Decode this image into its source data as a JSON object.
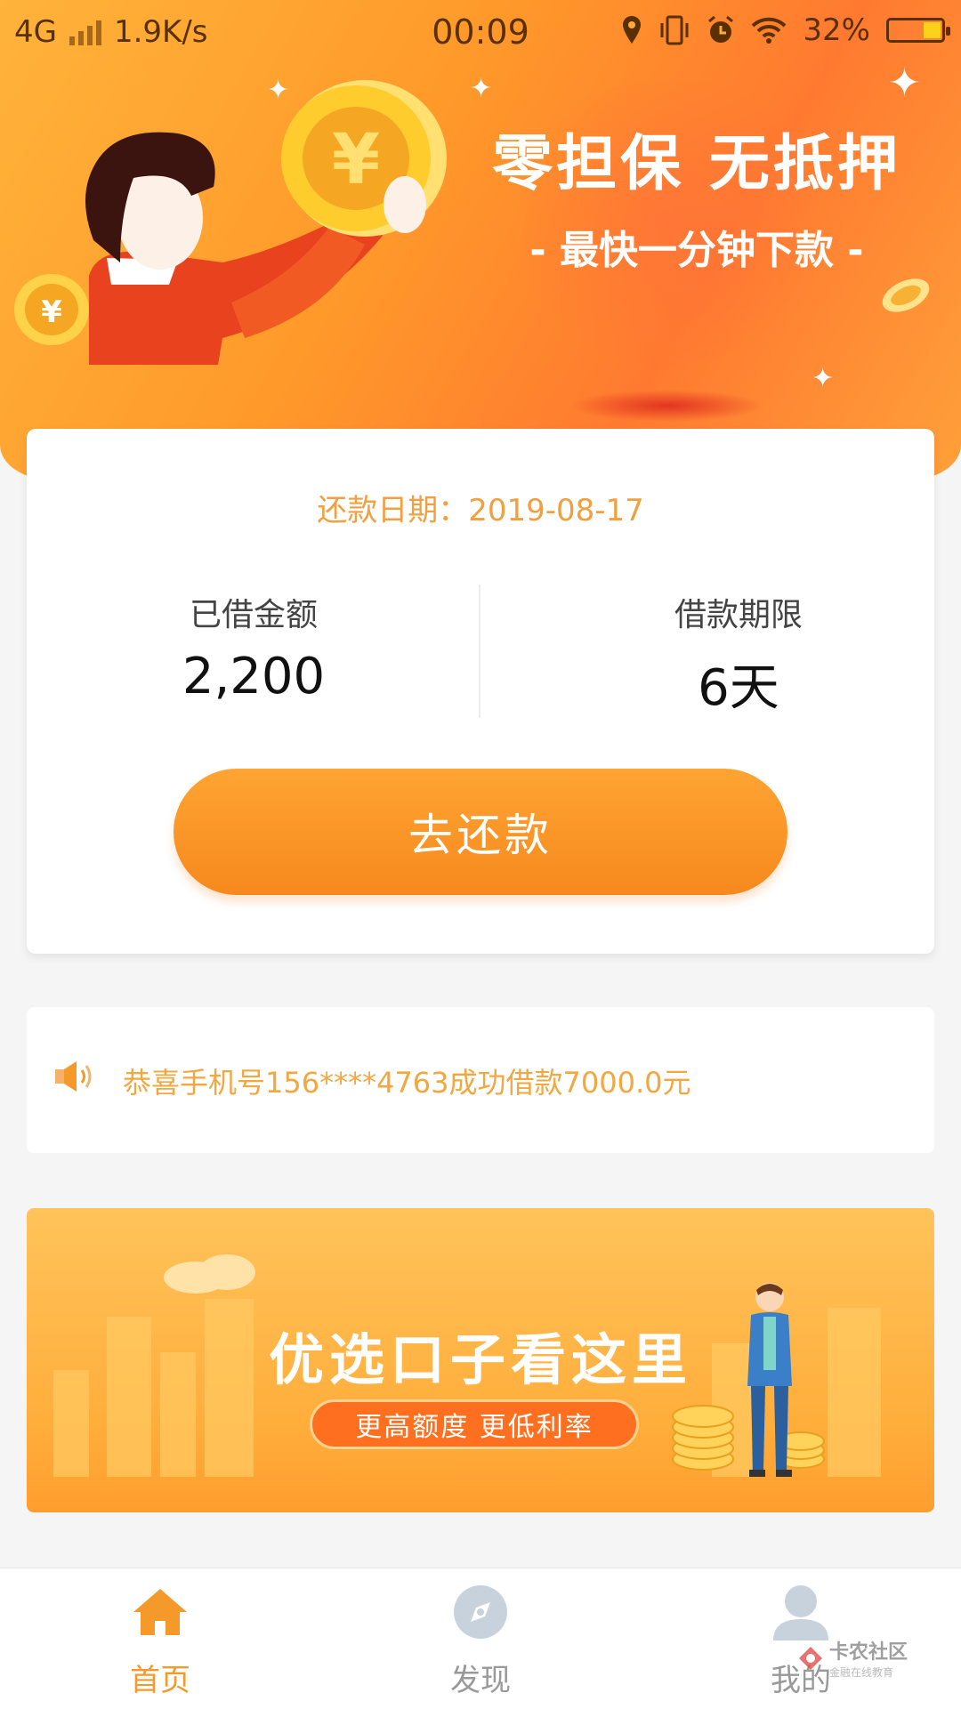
{
  "status_bar": {
    "network": "4G",
    "speed": "1.9K/s",
    "time": "00:09",
    "battery": "32%",
    "battery_level": 0.32
  },
  "hero": {
    "title": "零担保 无抵押",
    "subtitle": "- 最快一分钟下款 -"
  },
  "loan_card": {
    "due_label": "还款日期：",
    "due_date": "2019-08-17",
    "amount_label": "已借金额",
    "amount_value": "2,200",
    "term_label": "借款期限",
    "term_value": "6天",
    "repay_button": "去还款"
  },
  "notice": {
    "text": "恭喜手机号156****4763成功借款7000.0元"
  },
  "promo": {
    "title": "优选口子看这里",
    "tagline": "更高额度 更低利率"
  },
  "tabs": [
    {
      "label": "首页",
      "icon": "home-icon",
      "active": true
    },
    {
      "label": "发现",
      "icon": "compass-icon",
      "active": false
    },
    {
      "label": "我的",
      "icon": "user-icon",
      "active": false
    }
  ],
  "watermark": {
    "name": "卡农社区",
    "sub": "金融在线教育"
  },
  "colors": {
    "accent": "#f59a2a",
    "notice_text": "#f3a73f",
    "hero_gradient_start": "#ffb33a",
    "hero_gradient_end": "#ff7a30"
  }
}
